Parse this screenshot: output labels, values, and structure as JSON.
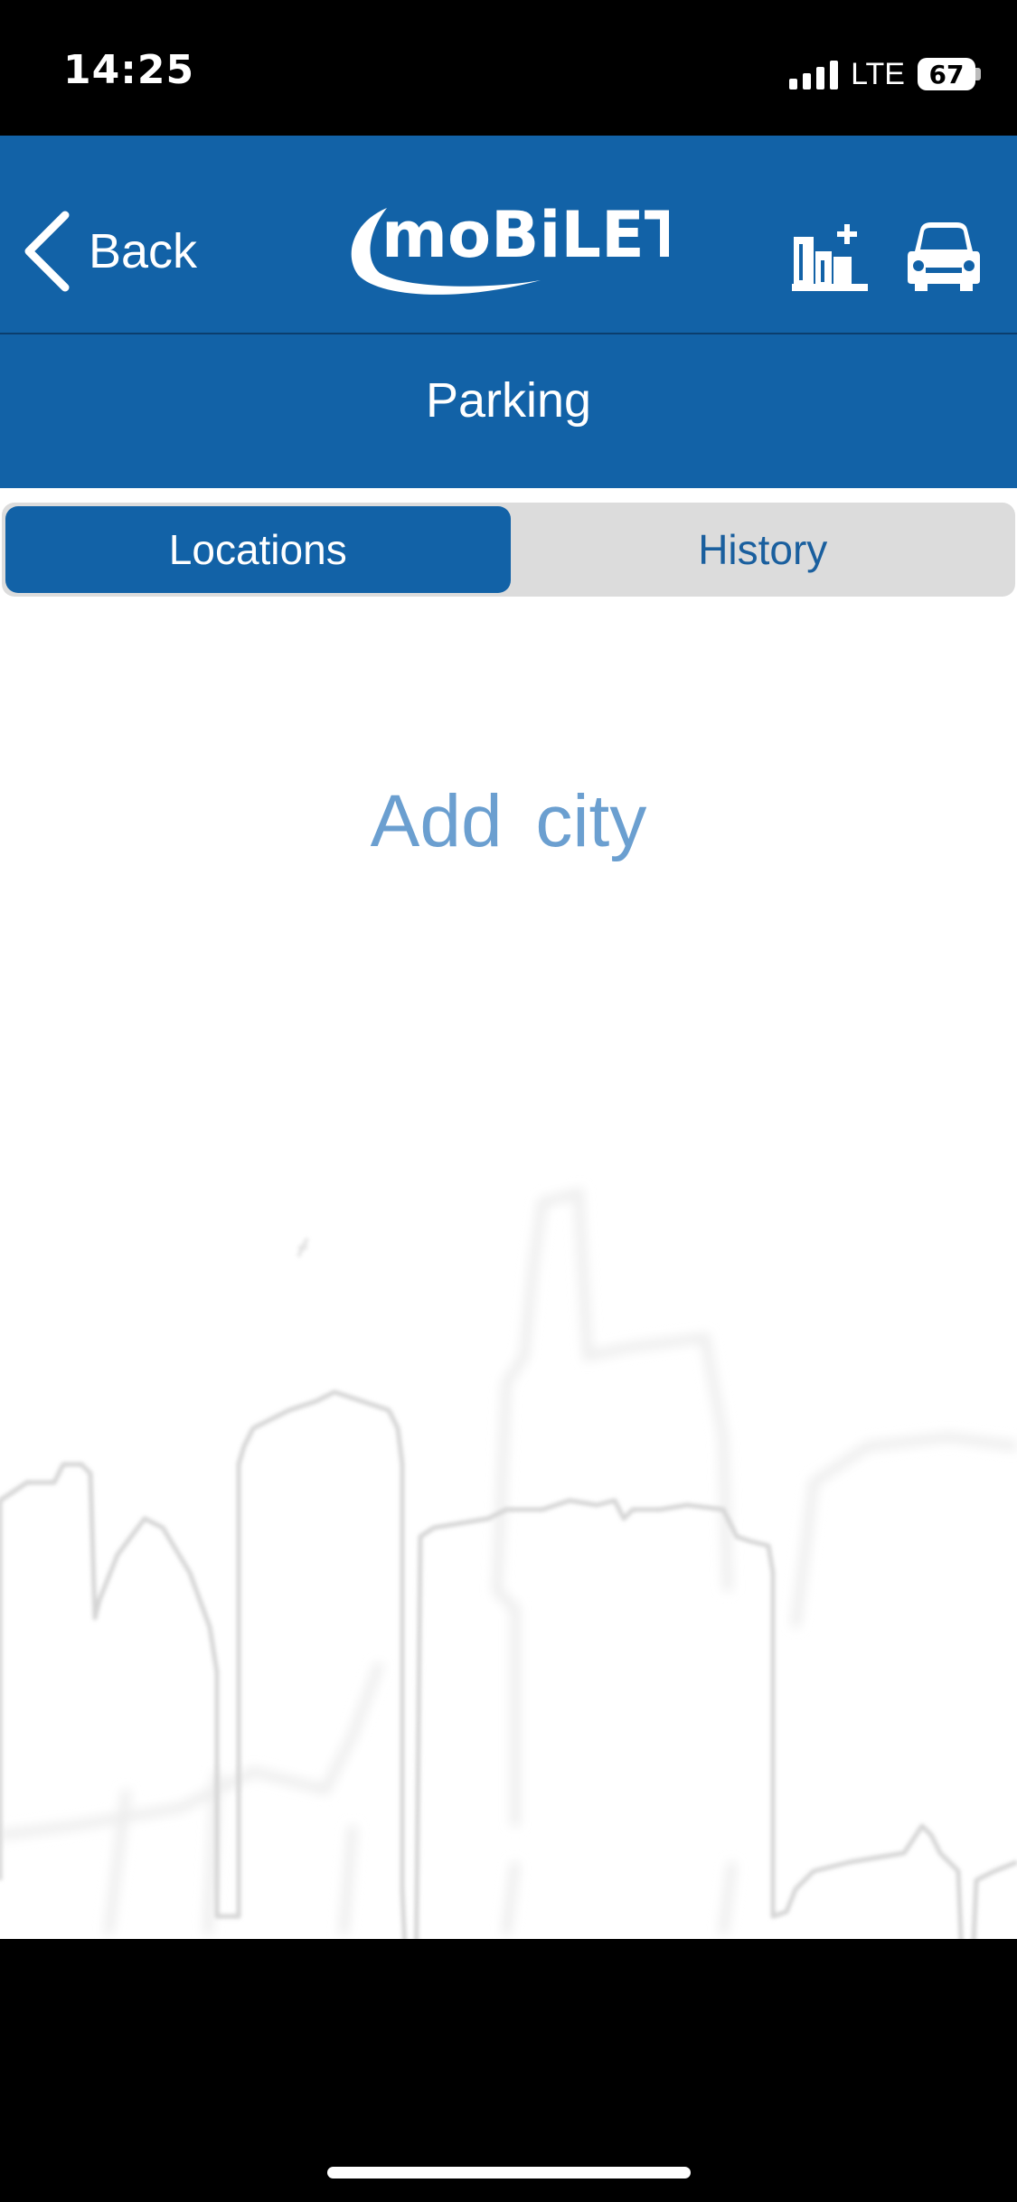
{
  "status_bar": {
    "time": "14:25",
    "network": "LTE",
    "battery": "67"
  },
  "header": {
    "back_label": "Back",
    "logo_text": "moBiLET",
    "icons": [
      "add-city-icon",
      "car-icon"
    ]
  },
  "subheader": {
    "title": "Parking"
  },
  "tabs": [
    {
      "label": "Locations",
      "active": true
    },
    {
      "label": "History",
      "active": false
    }
  ],
  "main": {
    "empty_action": "Add city"
  },
  "colors": {
    "brand_blue": "#1262a7",
    "link_blue": "#6b9fd0",
    "tab_inactive_bg": "#dcdcdc"
  }
}
